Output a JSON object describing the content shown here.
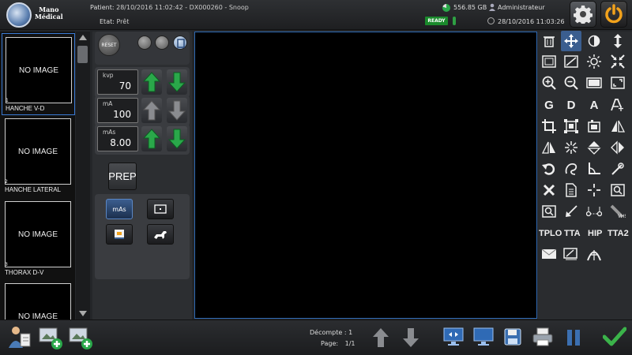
{
  "header": {
    "logo_line1": "Mano",
    "logo_line2": "Médical",
    "patient_label": "Patient:",
    "patient_value": "28/10/2016 11:02:42 - DX000260 - Snoop",
    "status_label": "Etat:",
    "status_value": "Prêt",
    "disk_space": "556.85 GB",
    "user": "Administrateur",
    "ready_badge": "READY",
    "datetime": "28/10/2016 11:03:26",
    "settings_icon": "gear-icon",
    "power_icon": "power-icon"
  },
  "thumbnails": [
    {
      "placeholder": "NO IMAGE",
      "number": "1",
      "label": "HANCHE V-D",
      "selected": true
    },
    {
      "placeholder": "NO IMAGE",
      "number": "2",
      "label": "HANCHE LATERAL",
      "selected": false
    },
    {
      "placeholder": "NO IMAGE",
      "number": "3",
      "label": "THORAX D-V",
      "selected": false
    },
    {
      "placeholder": "NO IMAGE",
      "number": "",
      "label": "",
      "selected": false
    }
  ],
  "controls": {
    "reset_label": "RESET",
    "kvp": {
      "label": "kvp",
      "value": "70"
    },
    "ma": {
      "label": "mA",
      "value": "100"
    },
    "mas": {
      "label": "mAs",
      "value": "8.00"
    },
    "prep_label": "PREP",
    "mode_mas_label": "mAs"
  },
  "tools": {
    "text_row": [
      "G",
      "D",
      "A"
    ],
    "labels": [
      "TPLO",
      "TTA",
      "HIP",
      "TTA2"
    ]
  },
  "footer": {
    "count_label": "Décompte :",
    "count_value": "1",
    "page_label": "Page:",
    "page_value": "1/1"
  },
  "colors": {
    "accent_blue": "#3b5e8f",
    "ready_green": "#1a8a2c",
    "arrow_green": "#2aa84a",
    "power_orange": "#f2a21b"
  }
}
